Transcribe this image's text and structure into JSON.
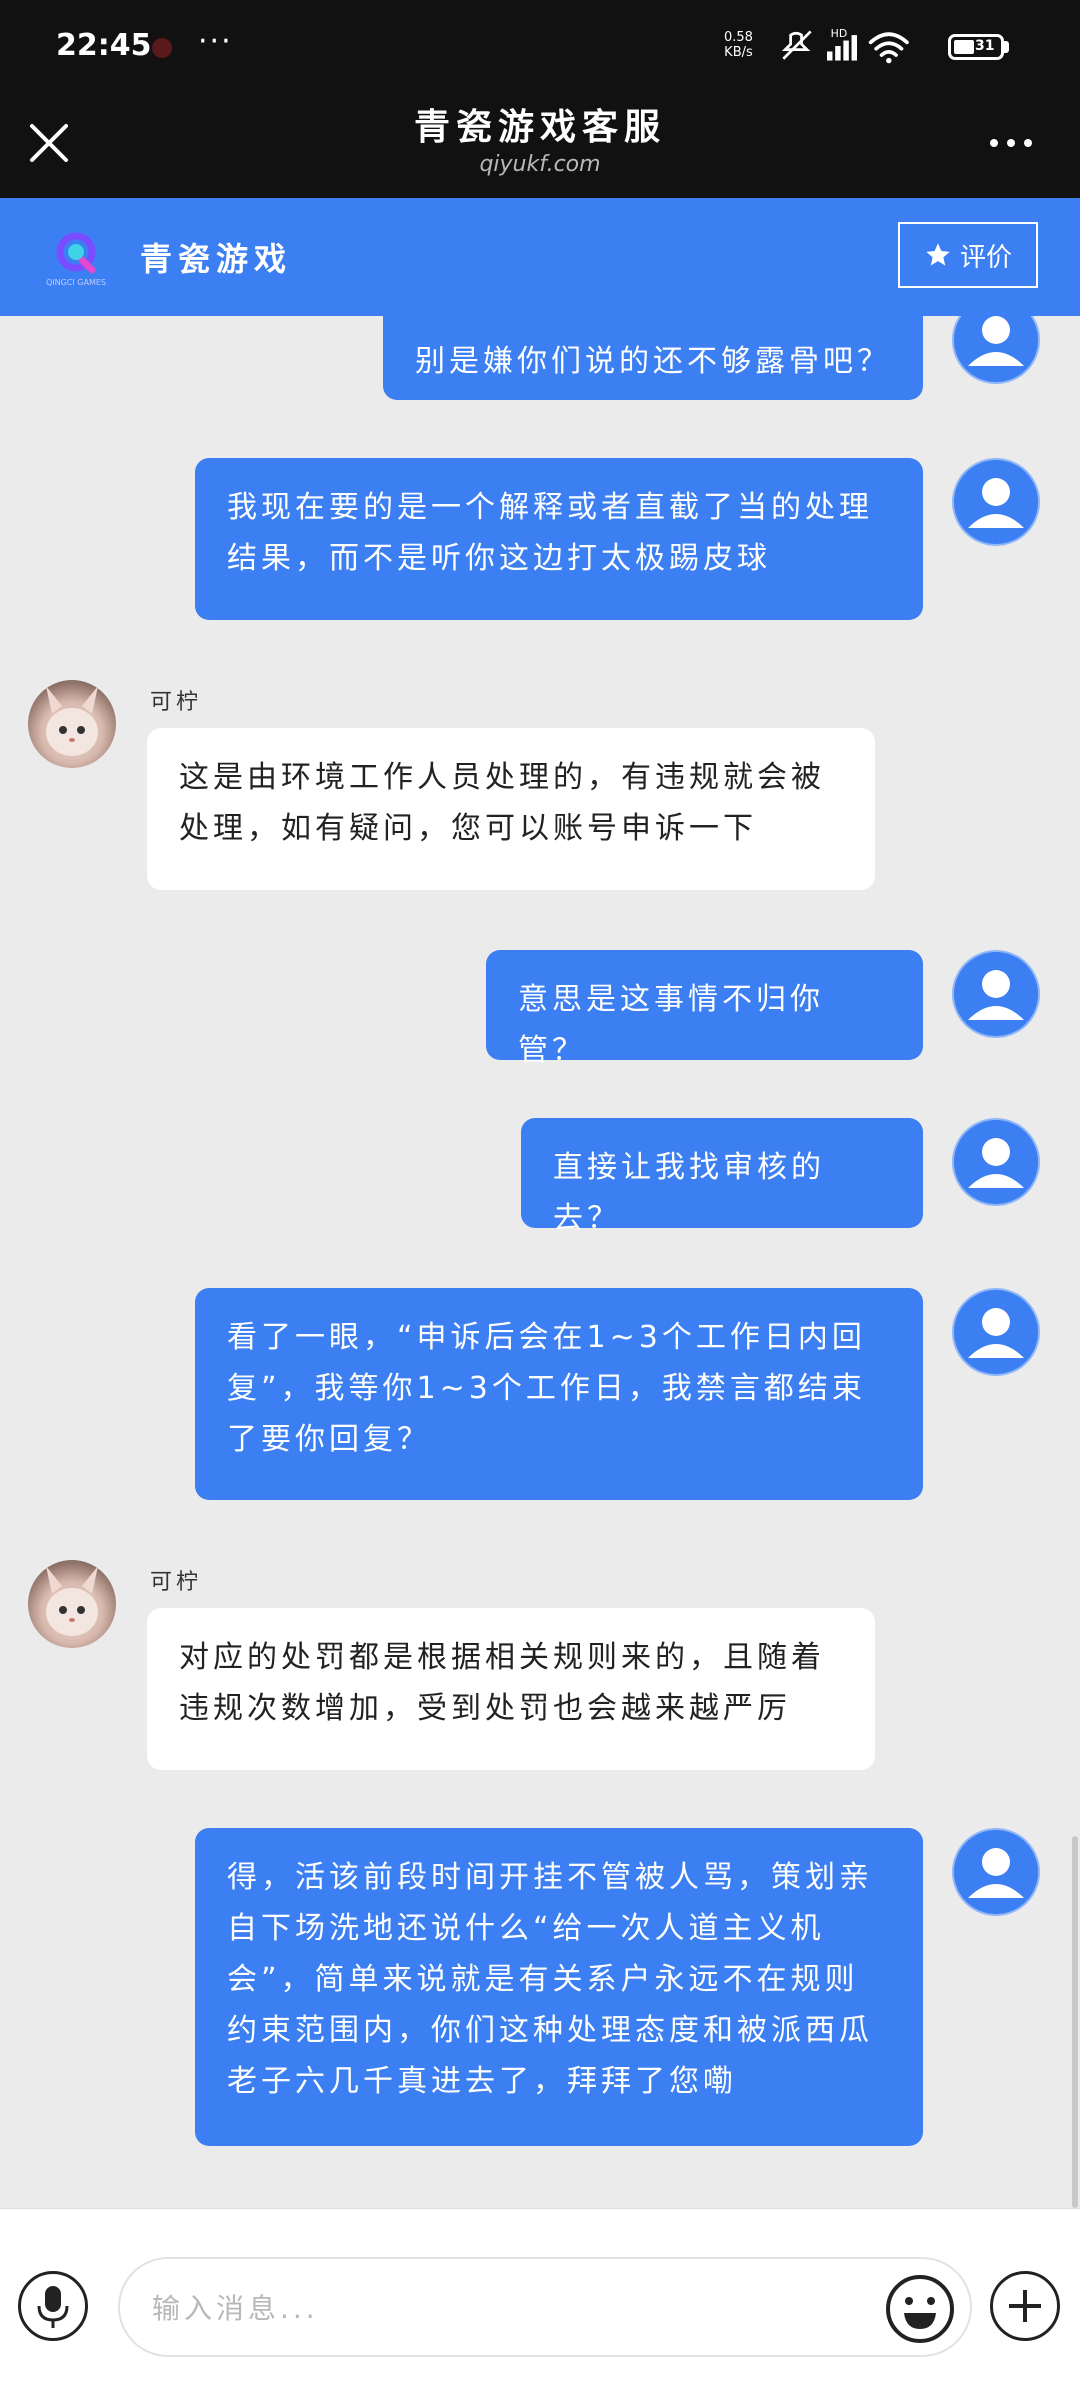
{
  "status_bar": {
    "time": "22:45",
    "more": "···",
    "net_speed_value": "0.58",
    "net_speed_unit": "KB/s",
    "network_label": "HD",
    "battery": "31"
  },
  "title_bar": {
    "title": "青瓷游戏客服",
    "subtitle": "qiyukf.com"
  },
  "brand_bar": {
    "logo_text": "QINGCI GAMES",
    "name": "青瓷游戏",
    "rate_label": "评价",
    "accent_color": "#3b7ff2"
  },
  "messages": [
    {
      "from": "user",
      "text": "别是嫌你们说的还不够露骨吧？"
    },
    {
      "from": "user",
      "text": "我现在要的是一个解释或者直截了当的处理结果，而不是听你这边打太极踢皮球"
    },
    {
      "from": "agent",
      "name": "可柠",
      "text": "这是由环境工作人员处理的，有违规就会被处理，如有疑问，您可以账号申诉一下"
    },
    {
      "from": "user",
      "text": "意思是这事情不归你管？"
    },
    {
      "from": "user",
      "text": "直接让我找审核的去？"
    },
    {
      "from": "user",
      "text": "看了一眼，“申诉后会在1~3个工作日内回复”，我等你1~3个工作日，我禁言都结束了要你回复？"
    },
    {
      "from": "agent",
      "name": "可柠",
      "text": "对应的处罚都是根据相关规则来的，且随着违规次数增加，受到处罚也会越来越严厉"
    },
    {
      "from": "user",
      "text": "得，活该前段时间开挂不管被人骂，策划亲自下场洗地还说什么“给一次人道主义机会”，简单来说就是有关系户永远不在规则约束范围内，你们这种处理态度和被派西瓜老子六几千真进去了，拜拜了您嘞"
    }
  ],
  "input": {
    "placeholder": "输入消息..."
  }
}
